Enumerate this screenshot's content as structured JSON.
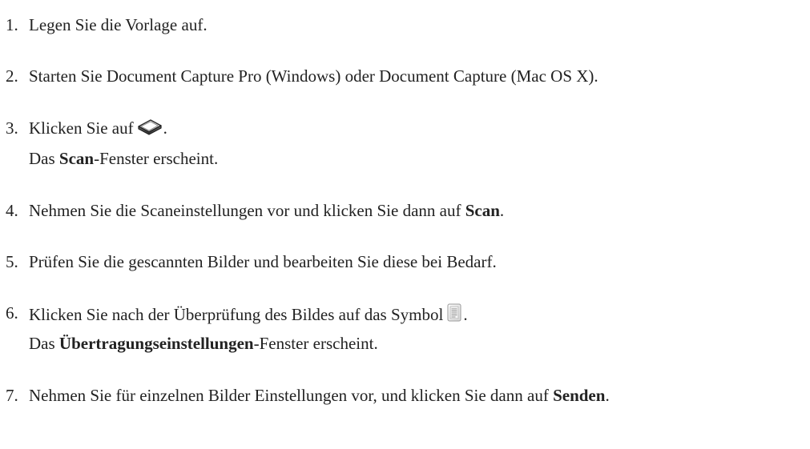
{
  "steps": [
    {
      "number": "1.",
      "text": "Legen Sie die Vorlage auf."
    },
    {
      "number": "2.",
      "text": "Starten Sie Document Capture Pro (Windows) oder Document Capture (Mac OS X)."
    },
    {
      "number": "3.",
      "text_before_icon": "Klicken Sie auf",
      "icon": "scanner-icon",
      "text_after_icon": ".",
      "result_prefix": "Das",
      "result_bold": "Scan",
      "result_suffix": "-Fenster erscheint."
    },
    {
      "number": "4.",
      "text_before_bold": "Nehmen Sie die Scaneinstellungen vor und klicken Sie dann auf",
      "bold": "Scan",
      "text_after_bold": "."
    },
    {
      "number": "5.",
      "text": "Prüfen Sie die gescannten Bilder und bearbeiten Sie diese bei Bedarf."
    },
    {
      "number": "6.",
      "text_before_icon": "Klicken Sie nach der Überprüfung des Bildes auf das Symbol",
      "icon": "transfer-settings-icon",
      "text_after_icon": ".",
      "result_prefix": "Das",
      "result_bold": "Übertragungseinstellungen",
      "result_suffix": "-Fenster erscheint."
    },
    {
      "number": "7.",
      "text_before_bold": "Nehmen Sie für einzelnen Bilder Einstellungen vor, und klicken Sie dann auf",
      "bold": "Senden",
      "text_after_bold": "."
    }
  ]
}
